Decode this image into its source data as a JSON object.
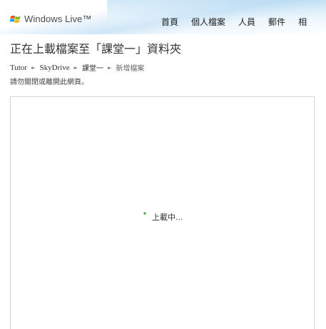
{
  "header": {
    "logo_text": "Windows Live™",
    "nav": [
      {
        "label": "首頁"
      },
      {
        "label": "個人檔案"
      },
      {
        "label": "人員"
      },
      {
        "label": "郵件"
      },
      {
        "label": "相"
      }
    ]
  },
  "page_title": "正在上載檔案至「課堂一」資料夾",
  "breadcrumb": {
    "items": [
      "Tutor",
      "SkyDrive",
      "課堂一",
      "新增檔案"
    ],
    "separator": "►"
  },
  "warning": "請勿關閉或離開此網頁。",
  "upload": {
    "status_text": "上載中...",
    "spinner_icon": "loading-spinner-icon",
    "spinner_color": "#3aa53a"
  },
  "colors": {
    "header_blue": "#cfe6f7",
    "panel_border": "#d6d6d6"
  }
}
